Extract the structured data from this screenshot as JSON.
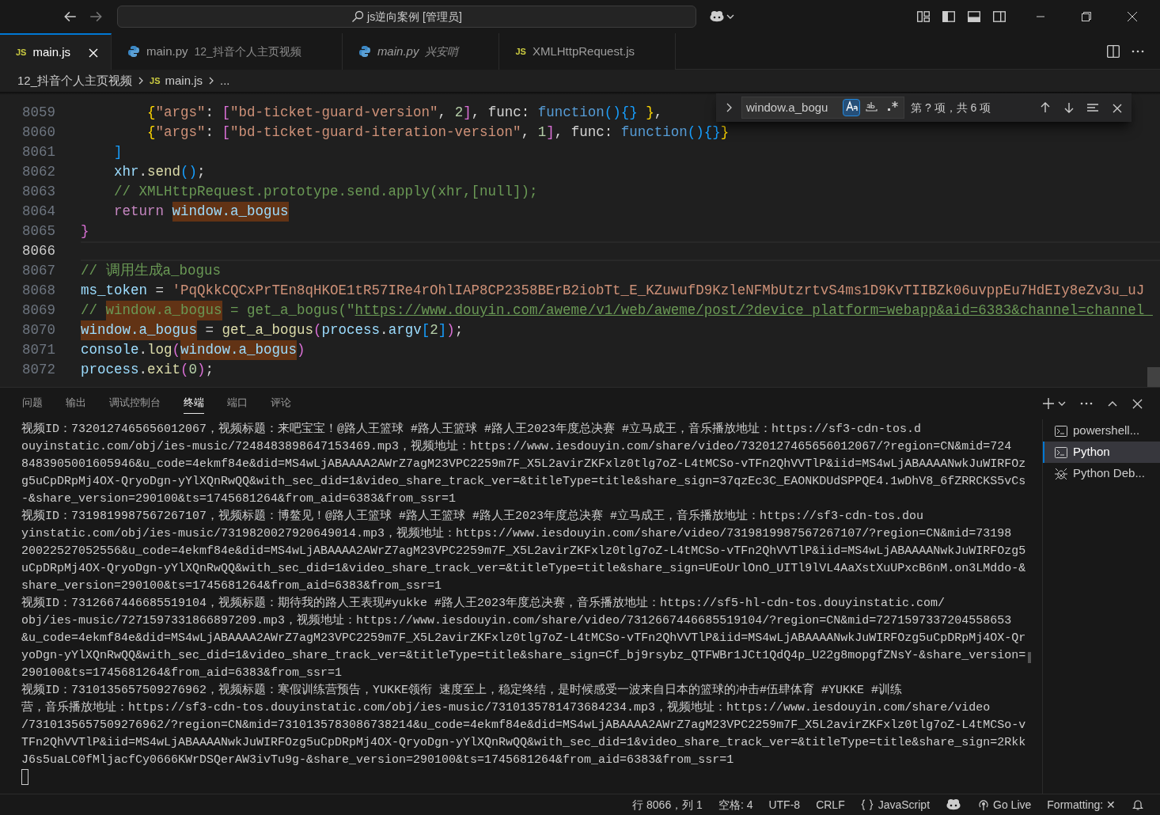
{
  "title_bar": {
    "search": "js逆向案例 [管理员]"
  },
  "tabs": [
    {
      "kind": "js",
      "badge": "JS",
      "label": "main.js",
      "selected": true,
      "preview": false
    },
    {
      "kind": "py",
      "label": "main.py",
      "description": "12_抖音个人主页视频",
      "selected": false,
      "preview": false
    },
    {
      "kind": "py",
      "label": "main.py",
      "description": "兴安哨",
      "selected": false,
      "preview": true
    },
    {
      "kind": "js",
      "badge": "JS",
      "label": "XMLHttpRequest.js",
      "selected": false,
      "preview": false
    }
  ],
  "breadcrumb": [
    {
      "kind": "folder",
      "label": "12_抖音个人主页视频"
    },
    {
      "kind": "js",
      "badge": "JS",
      "label": "main.js"
    },
    {
      "kind": "more",
      "label": "..."
    }
  ],
  "editor": {
    "lines": [
      {
        "num": "8059",
        "current": false,
        "tokens": [
          {
            "kind": "b1",
            "text": "        {"
          },
          {
            "kind": "str",
            "text": "\"args\""
          },
          {
            "kind": "plain",
            "text": ": "
          },
          {
            "kind": "b2",
            "text": "["
          },
          {
            "kind": "str",
            "text": "\"bd-ticket-guard-version\""
          },
          {
            "kind": "plain",
            "text": ", "
          },
          {
            "kind": "num",
            "text": "2"
          },
          {
            "kind": "b2",
            "text": "]"
          },
          {
            "kind": "plain",
            "text": ", func: "
          },
          {
            "kind": "storage",
            "text": "function"
          },
          {
            "kind": "b3",
            "text": "(){}"
          },
          {
            "kind": "b1",
            "text": " }"
          },
          {
            "kind": "plain",
            "text": ","
          }
        ]
      },
      {
        "num": "8060",
        "current": false,
        "tokens": [
          {
            "kind": "b1",
            "text": "        {"
          },
          {
            "kind": "str",
            "text": "\"args\""
          },
          {
            "kind": "plain",
            "text": ": "
          },
          {
            "kind": "b2",
            "text": "["
          },
          {
            "kind": "str",
            "text": "\"bd-ticket-guard-iteration-version\""
          },
          {
            "kind": "plain",
            "text": ", "
          },
          {
            "kind": "num",
            "text": "1"
          },
          {
            "kind": "b2",
            "text": "]"
          },
          {
            "kind": "plain",
            "text": ", func: "
          },
          {
            "kind": "storage",
            "text": "function"
          },
          {
            "kind": "b3",
            "text": "(){}"
          },
          {
            "kind": "b1",
            "text": "}"
          }
        ]
      },
      {
        "num": "8061",
        "current": false,
        "tokens": [
          {
            "kind": "b3",
            "text": "    ]"
          }
        ]
      },
      {
        "num": "8062",
        "current": false,
        "tokens": [
          {
            "kind": "var",
            "text": "    xhr"
          },
          {
            "kind": "plain",
            "text": "."
          },
          {
            "kind": "fn",
            "text": "send"
          },
          {
            "kind": "b3",
            "text": "()"
          },
          {
            "kind": "plain",
            "text": ";"
          }
        ]
      },
      {
        "num": "8063",
        "current": false,
        "tokens": [
          {
            "kind": "comment",
            "text": "    // XMLHttpRequest.prototype.send.apply(xhr,[null]);"
          }
        ]
      },
      {
        "num": "8064",
        "current": false,
        "tokens": [
          {
            "kind": "kw",
            "text": "    return "
          },
          {
            "kind": "var",
            "text": "window.a_bogus",
            "hl": true
          }
        ]
      },
      {
        "num": "8065",
        "current": false,
        "tokens": [
          {
            "kind": "b2",
            "text": "}"
          }
        ]
      },
      {
        "num": "8066",
        "current": true
      },
      {
        "num": "8067",
        "current": false,
        "tokens": [
          {
            "kind": "comment",
            "text": "// 调用生成a_bogus"
          }
        ]
      },
      {
        "num": "8068",
        "current": false,
        "tokens": [
          {
            "kind": "var",
            "text": "ms_token"
          },
          {
            "kind": "plain",
            "text": " = "
          },
          {
            "kind": "str",
            "text": "'PqQkkCQCxPrTEn8qHKOE1tR57IRe4rOhlIAP8CP2358BErB2iobTt_E_KZuwufD9KzleNFMbUtzrtvS4ms1D9KvTIIBZk06uvppEu7HdEIy8eZv3u_uJ"
          }
        ]
      },
      {
        "num": "8069",
        "current": false,
        "tokens": [
          {
            "kind": "comment",
            "text": "// "
          },
          {
            "kind": "comment",
            "text": "window.a_bogus",
            "hl": true
          },
          {
            "kind": "comment",
            "text": " = get_a_bogus(\""
          },
          {
            "kind": "link",
            "text": "https://www.douyin.com/aweme/v1/web/aweme/post/?device_platform=webapp&aid=6383&channel=channel_"
          }
        ]
      },
      {
        "num": "8070",
        "current": false,
        "tokens": [
          {
            "kind": "var",
            "text": "window.a_bogus",
            "hl": true
          },
          {
            "kind": "plain",
            "text": " = "
          },
          {
            "kind": "fn",
            "text": "get_a_bogus"
          },
          {
            "kind": "b2",
            "text": "("
          },
          {
            "kind": "var",
            "text": "process"
          },
          {
            "kind": "plain",
            "text": "."
          },
          {
            "kind": "var",
            "text": "argv"
          },
          {
            "kind": "b3",
            "text": "["
          },
          {
            "kind": "num",
            "text": "2"
          },
          {
            "kind": "b3",
            "text": "]"
          },
          {
            "kind": "b2",
            "text": ")"
          },
          {
            "kind": "plain",
            "text": ";"
          }
        ]
      },
      {
        "num": "8071",
        "current": false,
        "tokens": [
          {
            "kind": "var",
            "text": "console"
          },
          {
            "kind": "plain",
            "text": "."
          },
          {
            "kind": "fn",
            "text": "log"
          },
          {
            "kind": "b2",
            "text": "("
          },
          {
            "kind": "var",
            "text": "window.a_bogus",
            "hl": true
          },
          {
            "kind": "b2",
            "text": ")"
          }
        ]
      },
      {
        "num": "8072",
        "current": false,
        "tokens": [
          {
            "kind": "var",
            "text": "process"
          },
          {
            "kind": "plain",
            "text": "."
          },
          {
            "kind": "fn",
            "text": "exit"
          },
          {
            "kind": "b2",
            "text": "("
          },
          {
            "kind": "num",
            "text": "0"
          },
          {
            "kind": "b2",
            "text": ")"
          },
          {
            "kind": "plain",
            "text": ";"
          }
        ]
      }
    ]
  },
  "find_widget": {
    "query": "window.a_bogu",
    "match_case": true,
    "whole_word": false,
    "regex": false,
    "result": "第 ? 项，共 6 项"
  },
  "panel": {
    "tabs": [
      {
        "label": "问题",
        "selected": false
      },
      {
        "label": "输出",
        "selected": false
      },
      {
        "label": "调试控制台",
        "selected": false
      },
      {
        "label": "终端",
        "selected": true
      },
      {
        "label": "端口",
        "selected": false
      },
      {
        "label": "评论",
        "selected": false
      }
    ],
    "terminal_lines": [
      "视频ID：7320127465656012067，视频标题：来吧宝宝！@路人王篮球 #路人王篮球 #路人王2023年度总决赛 #立马成王，音乐播放地址：https://sf3-cdn-tos.d",
      "ouyinstatic.com/obj/ies-music/7248483898647153469.mp3，视频地址：https://www.iesdouyin.com/share/video/7320127465656012067/?region=CN&mid=724",
      "8483905001605946&u_code=4ekmf84e&did=MS4wLjABAAAA2AWrZ7agM23VPC2259m7F_X5L2avirZKFxlz0tlg7oZ-L4tMCSo-vTFn2QhVVTlP&iid=MS4wLjABAAAANwkJuWIRFOz",
      "g5uCpDRpMj4OX-QryoDgn-yYlXQnRwQQ&with_sec_did=1&video_share_track_ver=&titleType=title&share_sign=37qzEc3C_EAONKDUdSPPQE4.1wDhV8_6fZRRCKS5vCs",
      "-&share_version=290100&ts=1745681264&from_aid=6383&from_ssr=1",
      "视频ID：7319819987567267107，视频标题：博鳌见！@路人王篮球 #路人王篮球 #路人王2023年度总决赛 #立马成王，音乐播放地址：https://sf3-cdn-tos.dou",
      "yinstatic.com/obj/ies-music/7319820027920649014.mp3，视频地址：https://www.iesdouyin.com/share/video/7319819987567267107/?region=CN&mid=73198",
      "20022527052556&u_code=4ekmf84e&did=MS4wLjABAAAA2AWrZ7agM23VPC2259m7F_X5L2avirZKFxlz0tlg7oZ-L4tMCSo-vTFn2QhVVTlP&iid=MS4wLjABAAAANwkJuWIRFOzg5",
      "uCpDRpMj4OX-QryoDgn-yYlXQnRwQQ&with_sec_did=1&video_share_track_ver=&titleType=title&share_sign=UEoUrlOnO_UITl9lVL4AaXstXuUPxcB6nM.on3LMddo-&",
      "share_version=290100&ts=1745681264&from_aid=6383&from_ssr=1",
      "视频ID：7312667446685519104，视频标题：期待我的路人王表现#yukke #路人王2023年度总决赛，音乐播放地址：https://sf5-hl-cdn-tos.douyinstatic.com/",
      "obj/ies-music/7271597331866897209.mp3，视频地址：https://www.iesdouyin.com/share/video/7312667446685519104/?region=CN&mid=7271597337204558653",
      "&u_code=4ekmf84e&did=MS4wLjABAAAA2AWrZ7agM23VPC2259m7F_X5L2avirZKFxlz0tlg7oZ-L4tMCSo-vTFn2QhVVTlP&iid=MS4wLjABAAAANwkJuWIRFOzg5uCpDRpMj4OX-Qr",
      "yoDgn-yYlXQnRwQQ&with_sec_did=1&video_share_track_ver=&titleType=title&share_sign=Cf_bj9rsybz_QTFWBr1JCt1QdQ4p_U22g8mopgfZNsY-&share_version=",
      "290100&ts=1745681264&from_aid=6383&from_ssr=1",
      "视频ID：7310135657509276962，视频标题：寒假训练营预告，YUKKE领衔 速度至上，稳定终结，是时候感受一波来自日本的篮球的冲击#伍肆体育 #YUKKE #训练",
      "营，音乐播放地址：https://sf3-cdn-tos.douyinstatic.com/obj/ies-music/7310135781473684234.mp3，视频地址：https://www.iesdouyin.com/share/video",
      "/7310135657509276962/?region=CN&mid=7310135783086738214&u_code=4ekmf84e&did=MS4wLjABAAAA2AWrZ7agM23VPC2259m7F_X5L2avirZKFxlz0tlg7oZ-L4tMCSo-v",
      "TFn2QhVVTlP&iid=MS4wLjABAAAANwkJuWIRFOzg5uCpDRpMj4OX-QryoDgn-yYlXQnRwQQ&with_sec_did=1&video_share_track_ver=&titleType=title&share_sign=2Rkk",
      "J6s5uaLC0fMljacfCy0666KWrDSQerAW3ivTu9g-&share_version=290100&ts=1745681264&from_aid=6383&from_ssr=1"
    ],
    "terminals": [
      {
        "kind": "shell",
        "label": "powershell...",
        "selected": false
      },
      {
        "kind": "shell",
        "label": "Python",
        "selected": true
      },
      {
        "kind": "debug",
        "label": "Python Deb...",
        "selected": false
      }
    ]
  },
  "status_bar": {
    "items": [
      {
        "kind": "text",
        "label": "行 8066，列 1"
      },
      {
        "kind": "text",
        "label": "空格: 4"
      },
      {
        "kind": "text",
        "label": "UTF-8"
      },
      {
        "kind": "text",
        "label": "CRLF"
      },
      {
        "kind": "language",
        "label": "JavaScript"
      },
      {
        "kind": "copilot"
      },
      {
        "kind": "golive",
        "label": "Go Live"
      },
      {
        "kind": "text",
        "label": "Formatting: ✕"
      },
      {
        "kind": "bell"
      }
    ]
  }
}
